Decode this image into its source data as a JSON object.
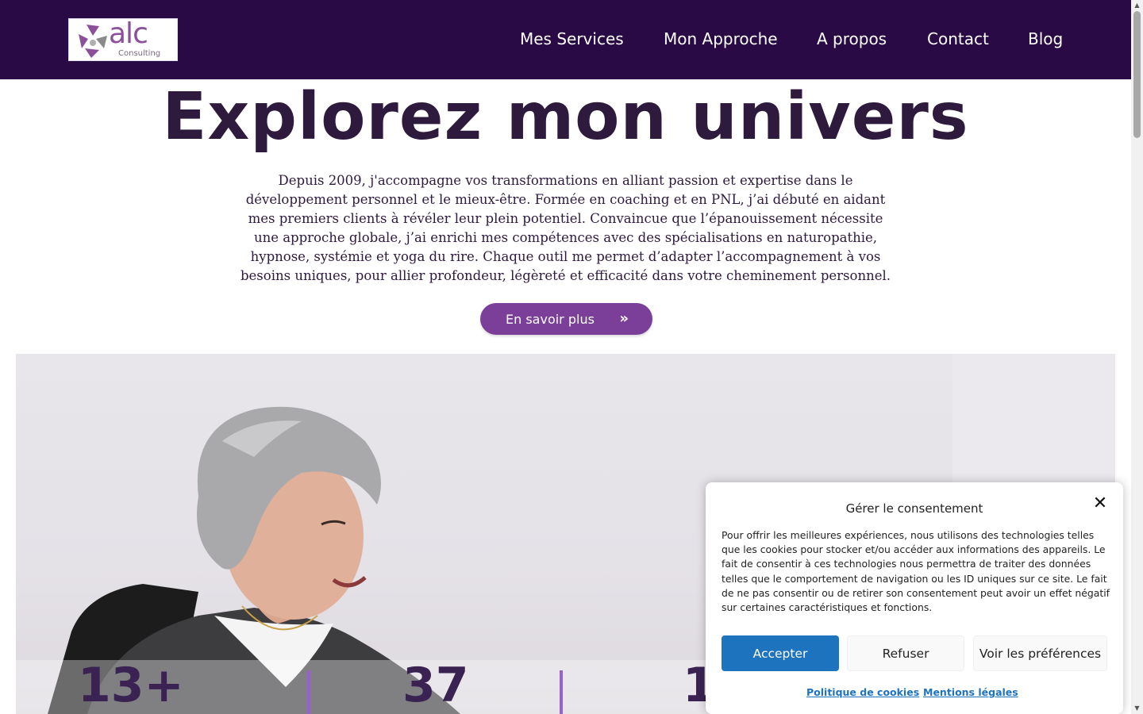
{
  "header": {
    "logo": {
      "word": "alc",
      "sub": "Consulting"
    },
    "nav": [
      {
        "label": "Mes Services"
      },
      {
        "label": "Mon Approche"
      },
      {
        "label": "A propos"
      },
      {
        "label": "Contact"
      },
      {
        "label": "Blog"
      }
    ]
  },
  "hero": {
    "title": "Explorez mon univers",
    "text": "Depuis 2009, j'accompagne vos transformations en alliant passion et expertise dans le développement personnel et le mieux-être. Formée en coaching et en PNL, j’ai débuté en aidant mes premiers clients à révéler leur plein potentiel. Convaincue que l’épanouissement nécessite une approche globale, j’ai enrichi mes compétences avec des spécialisations en naturopathie, hypnose, systémie et yoga du rire. Chaque outil me permet d’adapter l’accompagnement à vos besoins uniques, pour allier profondeur, légèreté et efficacité dans votre cheminement personnel.",
    "cta_label": "En savoir plus",
    "cta_icon": "»"
  },
  "stats": [
    {
      "value": "13+"
    },
    {
      "value": "37"
    },
    {
      "value": "1"
    }
  ],
  "consent": {
    "title": "Gérer le consentement",
    "close_icon": "✕",
    "body": "Pour offrir les meilleures expériences, nous utilisons des technologies telles que les cookies pour stocker et/ou accéder aux informations des appareils. Le fait de consentir à ces technologies nous permettra de traiter des données telles que le comportement de navigation ou les ID uniques sur ce site. Le fait de ne pas consentir ou de retirer son consentement peut avoir un effet négatif sur certaines caractéristiques et fonctions.",
    "accept_label": "Accepter",
    "refuse_label": "Refuser",
    "prefs_label": "Voir les préférences",
    "cookie_policy_label": "Politique de cookies",
    "legal_label": "Mentions légales"
  },
  "colors": {
    "header_bg": "#2a0a45",
    "accent_purple": "#7b3f99",
    "title_text": "#2e1a3d",
    "accept_blue": "#1e73be"
  }
}
